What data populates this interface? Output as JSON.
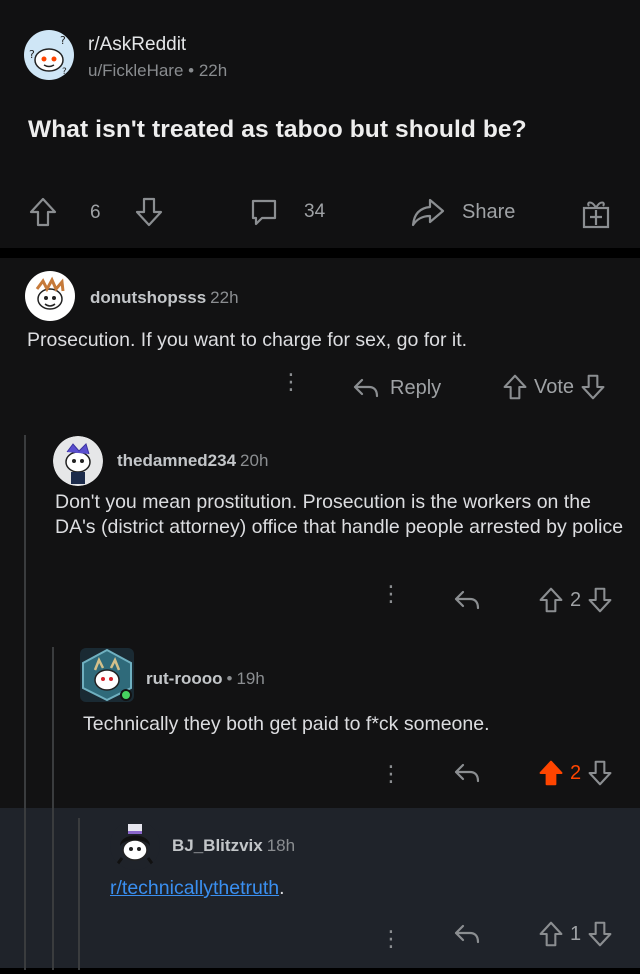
{
  "post": {
    "subreddit": "r/AskReddit",
    "author": "u/FickleHare",
    "separator": "•",
    "age": "22h",
    "title": "What isn't treated as taboo but should be?",
    "upvotes": "6",
    "comments": "34",
    "share_label": "Share"
  },
  "comments": [
    {
      "username": "donutshopsss",
      "age": "22h",
      "body": "Prosecution. If you want to charge for sex, go for it.",
      "reply_label": "Reply",
      "vote_label": "Vote"
    },
    {
      "username": "thedamned234",
      "age": "20h",
      "body": "Don't you mean prostitution. Prosecution is the workers on the  DA's (district attorney) office that handle people arrested by police",
      "score": "2"
    },
    {
      "username": "rut-roooo",
      "separator": "•",
      "age": "19h",
      "body": "Technically they both get paid to f*ck someone.",
      "score": "2",
      "upvoted": true
    },
    {
      "username": "BJ_Blitzvix",
      "age": "18h",
      "link": "r/technicallythetruth",
      "trailing": ".",
      "score": "1"
    }
  ],
  "colors": {
    "upvote_active": "#ff4500",
    "link": "#3a8ff0",
    "highlight_bg": "#1f232a",
    "online": "#46d160"
  },
  "icons": [
    "upvote-icon",
    "downvote-icon",
    "comment-icon",
    "share-icon",
    "award-icon",
    "reply-icon",
    "more-icon"
  ]
}
